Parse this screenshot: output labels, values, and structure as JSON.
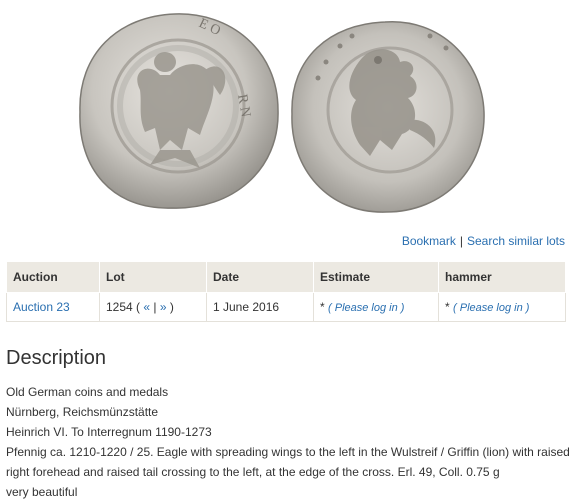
{
  "links": {
    "bookmark": "Bookmark",
    "separator": "|",
    "search_similar": "Search similar lots"
  },
  "table": {
    "headers": [
      "Auction",
      "Lot",
      "Date",
      "Estimate",
      "hammer"
    ],
    "row": {
      "auction": "Auction 23",
      "lot_number": "1254",
      "lot_prev": "«",
      "lot_sep": "|",
      "lot_next": "»",
      "lot_open": "(",
      "lot_close": ")",
      "date": "1 June 2016",
      "estimate_prefix": "*",
      "estimate_link": "( Please log in )",
      "hammer_prefix": "*",
      "hammer_link": "( Please log in )"
    }
  },
  "description": {
    "title": "Description",
    "lines": [
      "Old German coins and medals",
      "Nürnberg, Reichsmünzstätte",
      "Heinrich VI. To Interregnum 1190-1273",
      "Pfennig ca. 1210-1220 / 25. Eagle with spreading wings to the left in the Wulstreif / Griffin (lion) with raised right forehead and raised tail crossing to the left, at the edge of the cross. Erl. 49, Coll. 0.75 g",
      "very beautiful"
    ]
  },
  "colors": {
    "link": "#2a6fb0",
    "header_bg": "#ece9e2",
    "coin_silver": "#c9c6c0"
  }
}
